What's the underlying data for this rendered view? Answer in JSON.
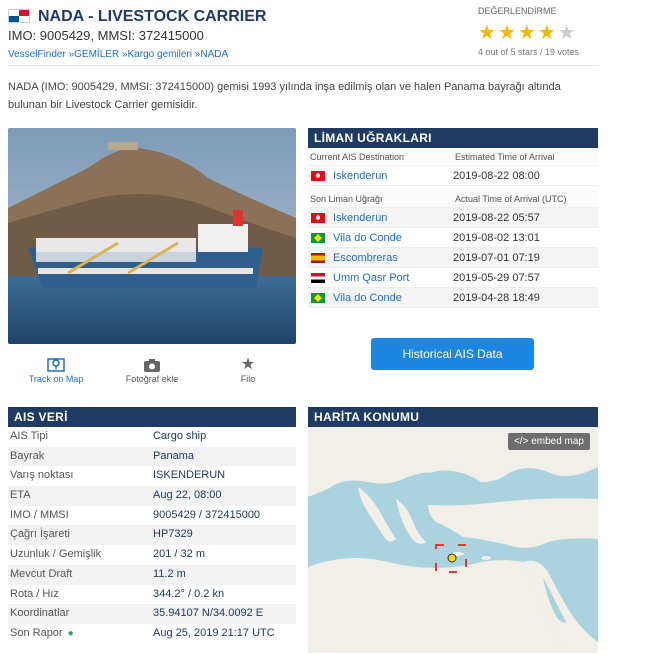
{
  "header": {
    "title": "NADA - LIVESTOCK CARRIER",
    "ids": "IMO: 9005429, MMSI: 372415000",
    "breadcrumb": [
      "VesselFinder",
      "GEMİLER",
      "Kargo gemileri",
      "NADA"
    ],
    "breadcrumb_sep": " »"
  },
  "rating": {
    "label": "DEĞERLENDİRME",
    "stars": 4,
    "max": 5,
    "text": "4 out of 5 stars / 19 votes"
  },
  "description": "NADA (IMO: 9005429, MMSI: 372415000) gemisi 1993 yılında inşa edilmiş olan ve halen Panama bayrağı altında bulunan bir Livestock Carrier gemisidir.",
  "actions": [
    {
      "label": "Track on Map",
      "icon": "map-pin-icon"
    },
    {
      "label": "Fotoğraf ekle",
      "icon": "camera-icon"
    },
    {
      "label": "Filo",
      "icon": "star-icon"
    }
  ],
  "port_calls": {
    "title": "LİMAN UĞRAKLARI",
    "current_header": {
      "col1": "Current AIS Destination",
      "col2": "Estimated Time of Arrival"
    },
    "current": {
      "flag": "tr",
      "port": "Iskenderun",
      "time": "2019-08-22 08:00"
    },
    "last_header": {
      "col1": "Son Liman Uğrağı",
      "col2": "Actual Time of Arrival (UTC)"
    },
    "last": [
      {
        "flag": "tr",
        "port": "Iskenderun",
        "time": "2019-08-22 05:57"
      },
      {
        "flag": "br",
        "port": "Vila do Conde",
        "time": "2019-08-02 13:01"
      },
      {
        "flag": "es",
        "port": "Escombreras",
        "time": "2019-07-01 07:19"
      },
      {
        "flag": "iq",
        "port": "Umm Qasr Port",
        "time": "2019-05-29 07:57"
      },
      {
        "flag": "br",
        "port": "Vila do Conde",
        "time": "2019-04-28 18:49"
      }
    ],
    "button": "Historical AIS Data"
  },
  "ais": {
    "title": "AIS VERİ",
    "rows": [
      {
        "key": "AIS Tipi",
        "value": "Cargo ship"
      },
      {
        "key": "Bayrak",
        "value": "Panama"
      },
      {
        "key": "Varış noktası",
        "value": "ISKENDERUN"
      },
      {
        "key": "ETA",
        "value": "Aug 22, 08:00"
      },
      {
        "key": "IMO / MMSI",
        "value": "9005429 / 372415000"
      },
      {
        "key": "Çağrı İşareti",
        "value": "HP7329"
      },
      {
        "key": "Uzunluk / Gemişlik",
        "value": "201 / 32 m"
      },
      {
        "key": "Mevcut Draft",
        "value": "11.2 m"
      },
      {
        "key": "Rota / Hız",
        "value": "344.2° / 0.2 kn"
      },
      {
        "key": "Koordinatlar",
        "value": "35.94107 N/34.0092 E"
      },
      {
        "key": "Son Rapor",
        "value": "Aug 25, 2019 21:17 UTC"
      }
    ]
  },
  "map": {
    "title": "HARİTA KONUMU",
    "embed_label": "</> embed map"
  },
  "colors": {
    "navy": "#1f3a63",
    "link": "#1d6fc4",
    "button": "#1d86e3",
    "star": "#f5b800",
    "marker_box": "#e23b2e"
  }
}
